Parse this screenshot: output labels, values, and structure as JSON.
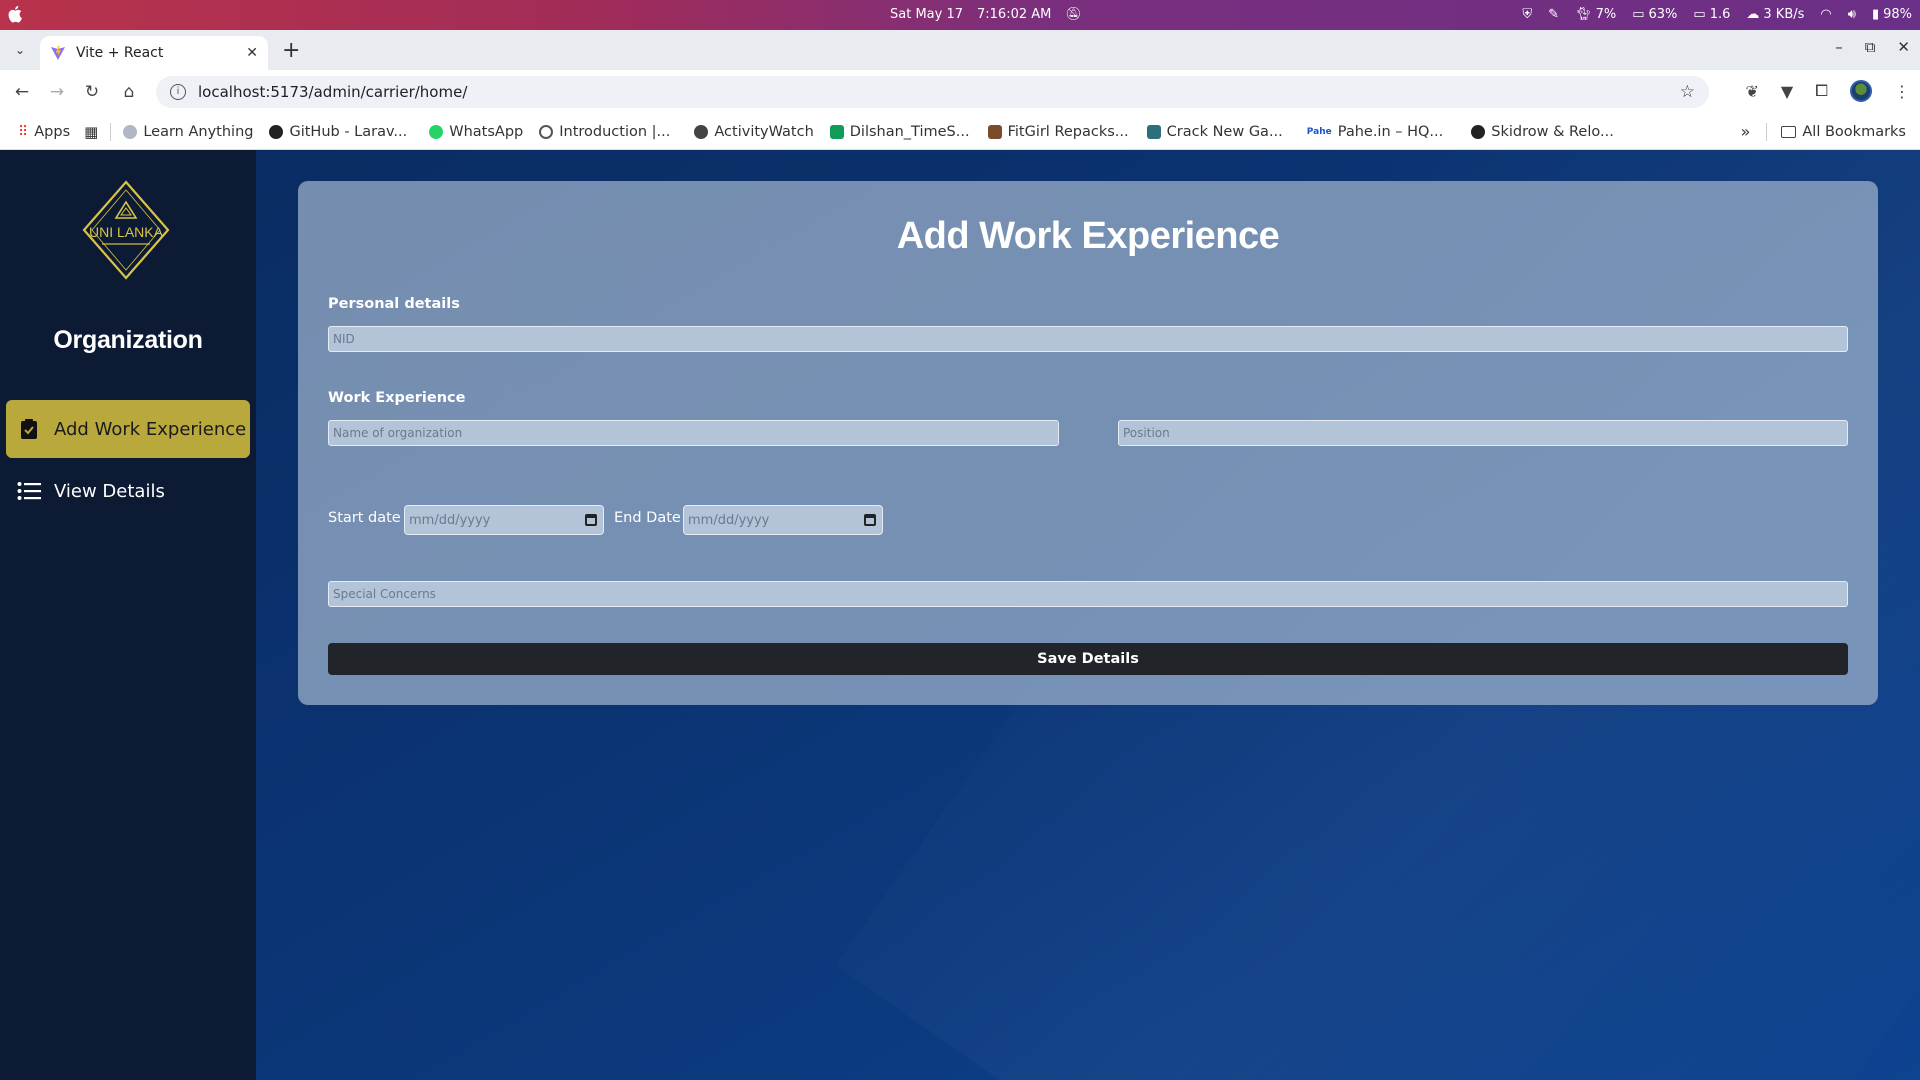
{
  "os_bar": {
    "date": "Sat May 17",
    "time": "7:16:02 AM",
    "cpu": "7%",
    "mem": "63%",
    "load": "1.6",
    "net": "3 KB/s",
    "battery": "98%"
  },
  "browser": {
    "tab_title": "Vite + React",
    "url": "localhost:5173/admin/carrier/home/",
    "bookmarks": [
      {
        "label": "Apps",
        "icon": "apps-grid-icon",
        "color": "#ea4335"
      },
      {
        "label": "Learn Anything",
        "icon": "cloud-icon",
        "color": "#b0b8c4"
      },
      {
        "label": "GitHub - Larav...",
        "icon": "github-icon",
        "color": "#222222"
      },
      {
        "label": "WhatsApp",
        "icon": "whatsapp-icon",
        "color": "#25d366"
      },
      {
        "label": "Introduction |...",
        "icon": "circle-c-icon",
        "color": "#555555"
      },
      {
        "label": "ActivityWatch",
        "icon": "activitywatch-icon",
        "color": "#444444"
      },
      {
        "label": "Dilshan_TimeS...",
        "icon": "sheets-icon",
        "color": "#0f9d58"
      },
      {
        "label": "FitGirl Repacks...",
        "icon": "fitgirl-icon",
        "color": "#7a4a2a"
      },
      {
        "label": "Crack New Ga...",
        "icon": "crack-icon",
        "color": "#2a6f7a"
      },
      {
        "label": "Pahe.in – HQ...",
        "icon": "pahe-icon",
        "color": "#1a56c9"
      },
      {
        "label": "Skidrow & Relo...",
        "icon": "skidrow-icon",
        "color": "#c0392b"
      }
    ],
    "all_bookmarks": "All Bookmarks"
  },
  "sidebar": {
    "logo_text": "UNI LANKA",
    "title": "Organization",
    "items": [
      {
        "label": "Add Work Experience",
        "icon": "clipboard-check-icon",
        "active": true
      },
      {
        "label": "View Details",
        "icon": "list-icon",
        "active": false
      }
    ]
  },
  "form": {
    "title": "Add Work Experience",
    "personal_label": "Personal details",
    "nid_placeholder": "NID",
    "work_label": "Work Experience",
    "org_placeholder": "Name of organization",
    "position_placeholder": "Position",
    "start_label": "Start date",
    "end_label": "End Date",
    "date_placeholder": "mm/dd/yyyy",
    "concerns_placeholder": "Special Concerns",
    "save_label": "Save Details"
  },
  "colors": {
    "sidebar_bg": "#0c1a33",
    "active_item": "#b9a83c",
    "card_bg": "#a0b4cd",
    "button_bg": "#212529"
  }
}
